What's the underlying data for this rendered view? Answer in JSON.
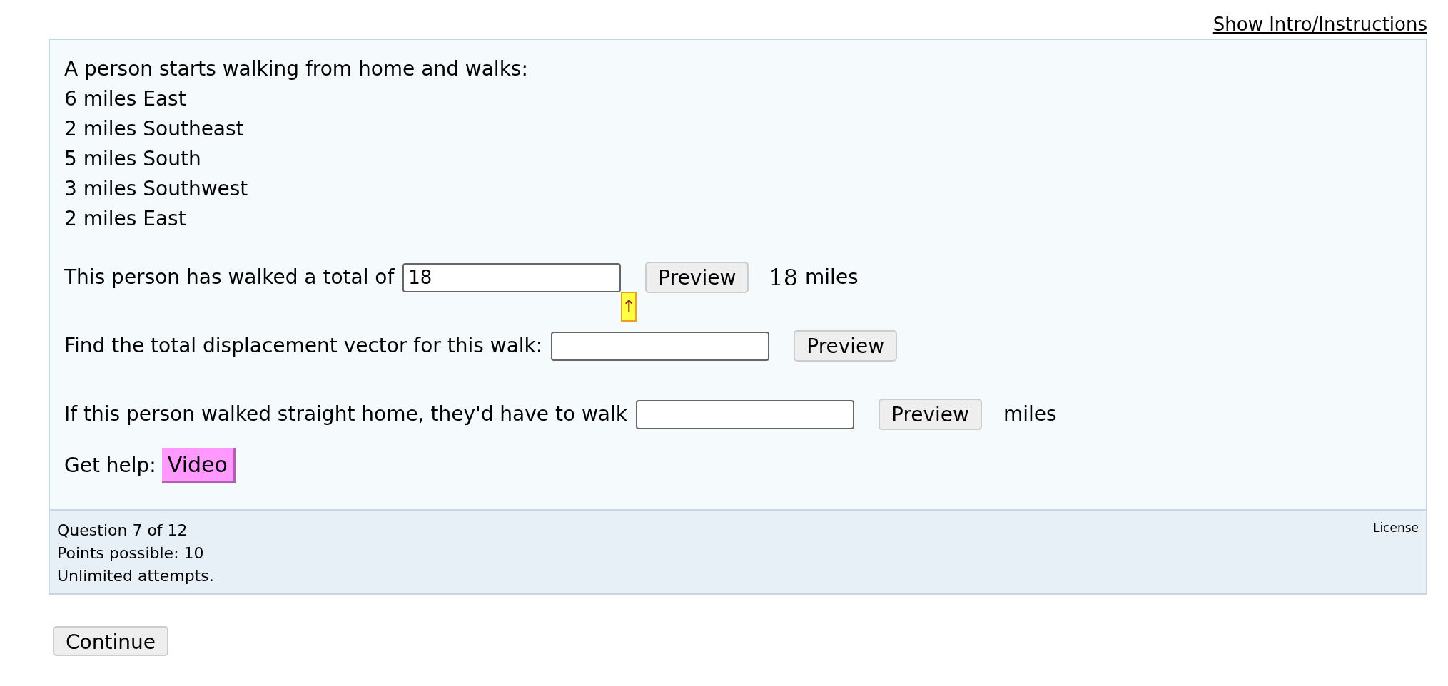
{
  "intro_link": "Show Intro/Instructions",
  "problem": {
    "lines": [
      "A person starts walking from home and walks:",
      "6 miles East",
      "2 miles Southeast",
      "5 miles South",
      "3 miles Southwest",
      "2 miles East"
    ]
  },
  "questions": [
    {
      "prompt": "This person has walked a total of",
      "value": "18",
      "button": "Preview",
      "rendered_math": "18",
      "suffix": "miles",
      "marker": "↑"
    },
    {
      "prompt": "Find the total displacement vector for this walk:",
      "button": "Preview"
    },
    {
      "prompt": "If this person walked straight home, they'd have to walk",
      "button": "Preview",
      "suffix": "miles"
    }
  ],
  "help": {
    "label": "Get help:",
    "button": "Video"
  },
  "footer": {
    "lines": [
      "Question 7 of 12",
      "Points possible: 10",
      "Unlimited attempts."
    ],
    "license": "License"
  },
  "continue_button": "Continue"
}
